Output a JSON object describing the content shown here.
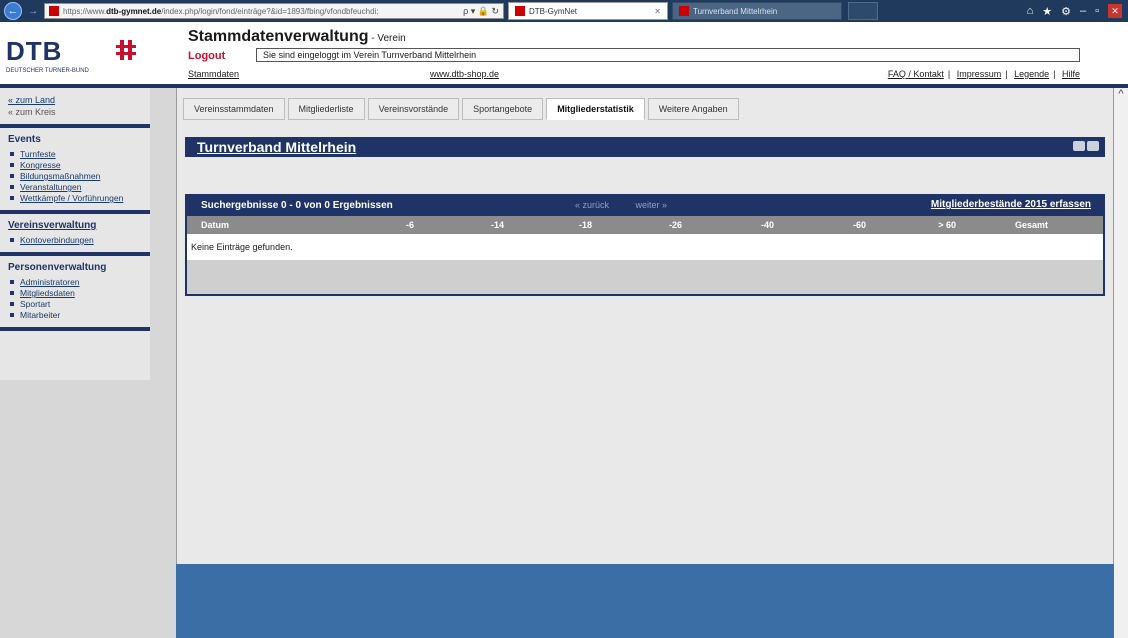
{
  "browser": {
    "url_prefix": "https://www.",
    "url_host": "dtb-gymnet.de",
    "url_rest": "/index.php/login/fond/einträge?&id=1893/fbing/vfondbfeuchdi: ",
    "url_controls": "ρ ▾ 🔒 ↻",
    "tab_active": "DTB-GymNet",
    "tab_inactive": "Turnverband Mittelrhein",
    "window_controls": [
      "⌂",
      "★",
      "⚙",
      "–",
      "▫"
    ],
    "close": "✕"
  },
  "header": {
    "logo_text": "DTB",
    "logo_subtitle": "DEUTSCHER TURNER-BUND",
    "title": "Stammdatenverwaltung",
    "title_suffix": " - Verein",
    "logout": "Logout",
    "status": "Sie sind eingeloggt im Verein Turnverband Mittelrhein",
    "link_stammdaten": "Stammdaten",
    "link_shop": "www.dtb-shop.de",
    "top_links": [
      "FAQ / Kontakt",
      "Impressum",
      "Legende",
      "Hilfe"
    ]
  },
  "sidebar": {
    "nav_land": "« zum Land",
    "nav_kreis": "« zum Kreis",
    "events_heading": "Events",
    "events_items": [
      "Turnfeste",
      "Kongresse",
      "Bildungsmaßnahmen",
      "Veranstaltungen",
      "Wettkämpfe / Vorführungen"
    ],
    "verein_heading": "Vereinsverwaltung",
    "verein_items": [
      "Kontoverbindungen"
    ],
    "personen_heading": "Personenverwaltung",
    "personen_items": [
      "Administratoren",
      "Mitgliedsdaten",
      "Sportart",
      "Mitarbeiter"
    ]
  },
  "tabs": [
    "Vereinsstammdaten",
    "Mitgliederliste",
    "Vereinsvorstände",
    "Sportangebote",
    "Mitgliederstatistik",
    "Weitere Angaben"
  ],
  "active_tab": "Mitgliederstatistik",
  "band_title": "Turnverband Mittelrhein",
  "results": {
    "summary": "Suchergebnisse 0 - 0 von 0 Ergebnissen",
    "prev": "« zurück",
    "next": "weiter »",
    "capture_link": "Mitgliederbestände 2015 erfassen",
    "columns": [
      "Datum",
      "-6",
      "-14",
      "-18",
      "-26",
      "-40",
      "-60",
      "> 60",
      "Gesamt"
    ],
    "empty": "Keine Einträge gefunden."
  },
  "colors": {
    "navy": "#1f3366",
    "accent_red": "#c8102e",
    "bottom_blue": "#3b6ea5"
  }
}
